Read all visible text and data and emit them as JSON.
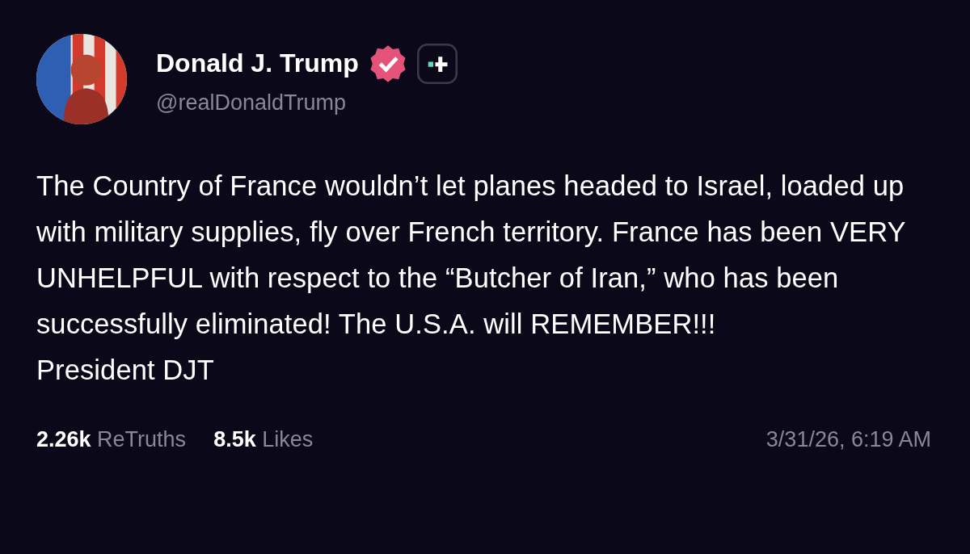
{
  "author": {
    "name": "Donald J. Trump",
    "handle": "@realDonaldTrump",
    "verified": true
  },
  "post": {
    "text": "The Country of France wouldn’t let planes headed to Israel, loaded up with military supplies, fly over French territory. France has been VERY UNHELPFUL with respect to the “Butcher of Iran,” who has been successfully eliminated! The U.S.A. will REMEMBER!!!\nPresident DJT"
  },
  "stats": [
    {
      "text": "**2.26k** ReTruths"
    },
    {
      "text": "**8.5k** Likes"
    }
  ],
  "timestamp": "3/31/26, 6:19 AM"
}
